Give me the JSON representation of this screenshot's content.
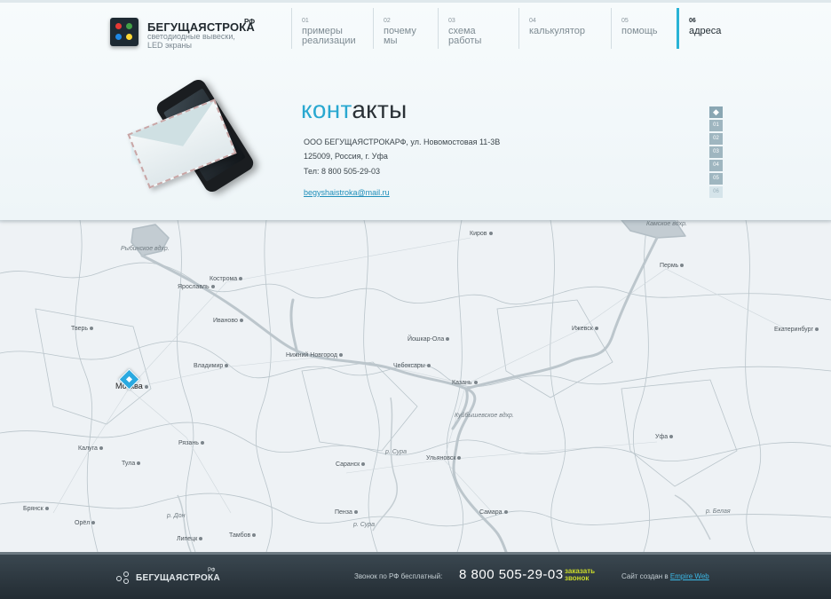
{
  "brand": {
    "title": "БЕГУЩАЯСТРОКА",
    "suffix": "РФ",
    "tagline": "светодиодные вывески, LED экраны",
    "logo_colors": [
      "#e53935",
      "#43a047",
      "#1e88e5",
      "#fdd835"
    ]
  },
  "nav": [
    {
      "num": "01",
      "label": "примеры\nреализации"
    },
    {
      "num": "02",
      "label": "почему\nмы"
    },
    {
      "num": "03",
      "label": "схема\nработы"
    },
    {
      "num": "04",
      "label": "калькулятор"
    },
    {
      "num": "05",
      "label": "помощь"
    },
    {
      "num": "06",
      "label": "адреса",
      "active": true
    }
  ],
  "contacts": {
    "title_accent": "конт",
    "title_rest": "акты",
    "line1": "ООО БЕГУЩАЯСТРОКАРФ, ул. Новомостовая 11-3В",
    "line2": "125009, Россия, г. Уфа",
    "phone": "Тел: 8 800 505-29-03",
    "email": "begyshaistroka@mail.ru"
  },
  "pager": {
    "home_icon": "diamond-icon",
    "pages": [
      "01",
      "02",
      "03",
      "04",
      "05",
      "06"
    ],
    "active": "06"
  },
  "map": {
    "cities": [
      "Киров",
      "Пермь",
      "Кострома",
      "Ярославль",
      "Тверь",
      "Иваново",
      "Йошкар-Ола",
      "Ижевск",
      "Екатеринбург",
      "Нижний Новгород",
      "Чебоксары",
      "Владимир",
      "Москва",
      "Казань",
      "Рязань",
      "Уфа",
      "Калуга",
      "Тула",
      "Саранск",
      "Ульяновск",
      "Брянск",
      "Пенза",
      "Самара",
      "Орёл",
      "Липецк",
      "Тамбов"
    ],
    "water_labels": [
      "Рыбинское вдхр.",
      "Камское вдхр.",
      "Куйбышевское вдхр.",
      "р. Сура",
      "р. Сура",
      "р. Дон",
      "р. Белая"
    ],
    "marker_icon": "location-diamond-icon",
    "accent": "#2aa9e0"
  },
  "footer": {
    "logo_text": "БЕГУЩАЯСТРОКА",
    "logo_rf": "РФ",
    "call_label": "Звонок по РФ бесплатный:",
    "phone": "8 800 505-29-03",
    "order_call": "заказать\nзвонок",
    "created_prefix": "Сайт создан в",
    "created_link": "Empire Web",
    "order_color": "#cddd2a"
  }
}
